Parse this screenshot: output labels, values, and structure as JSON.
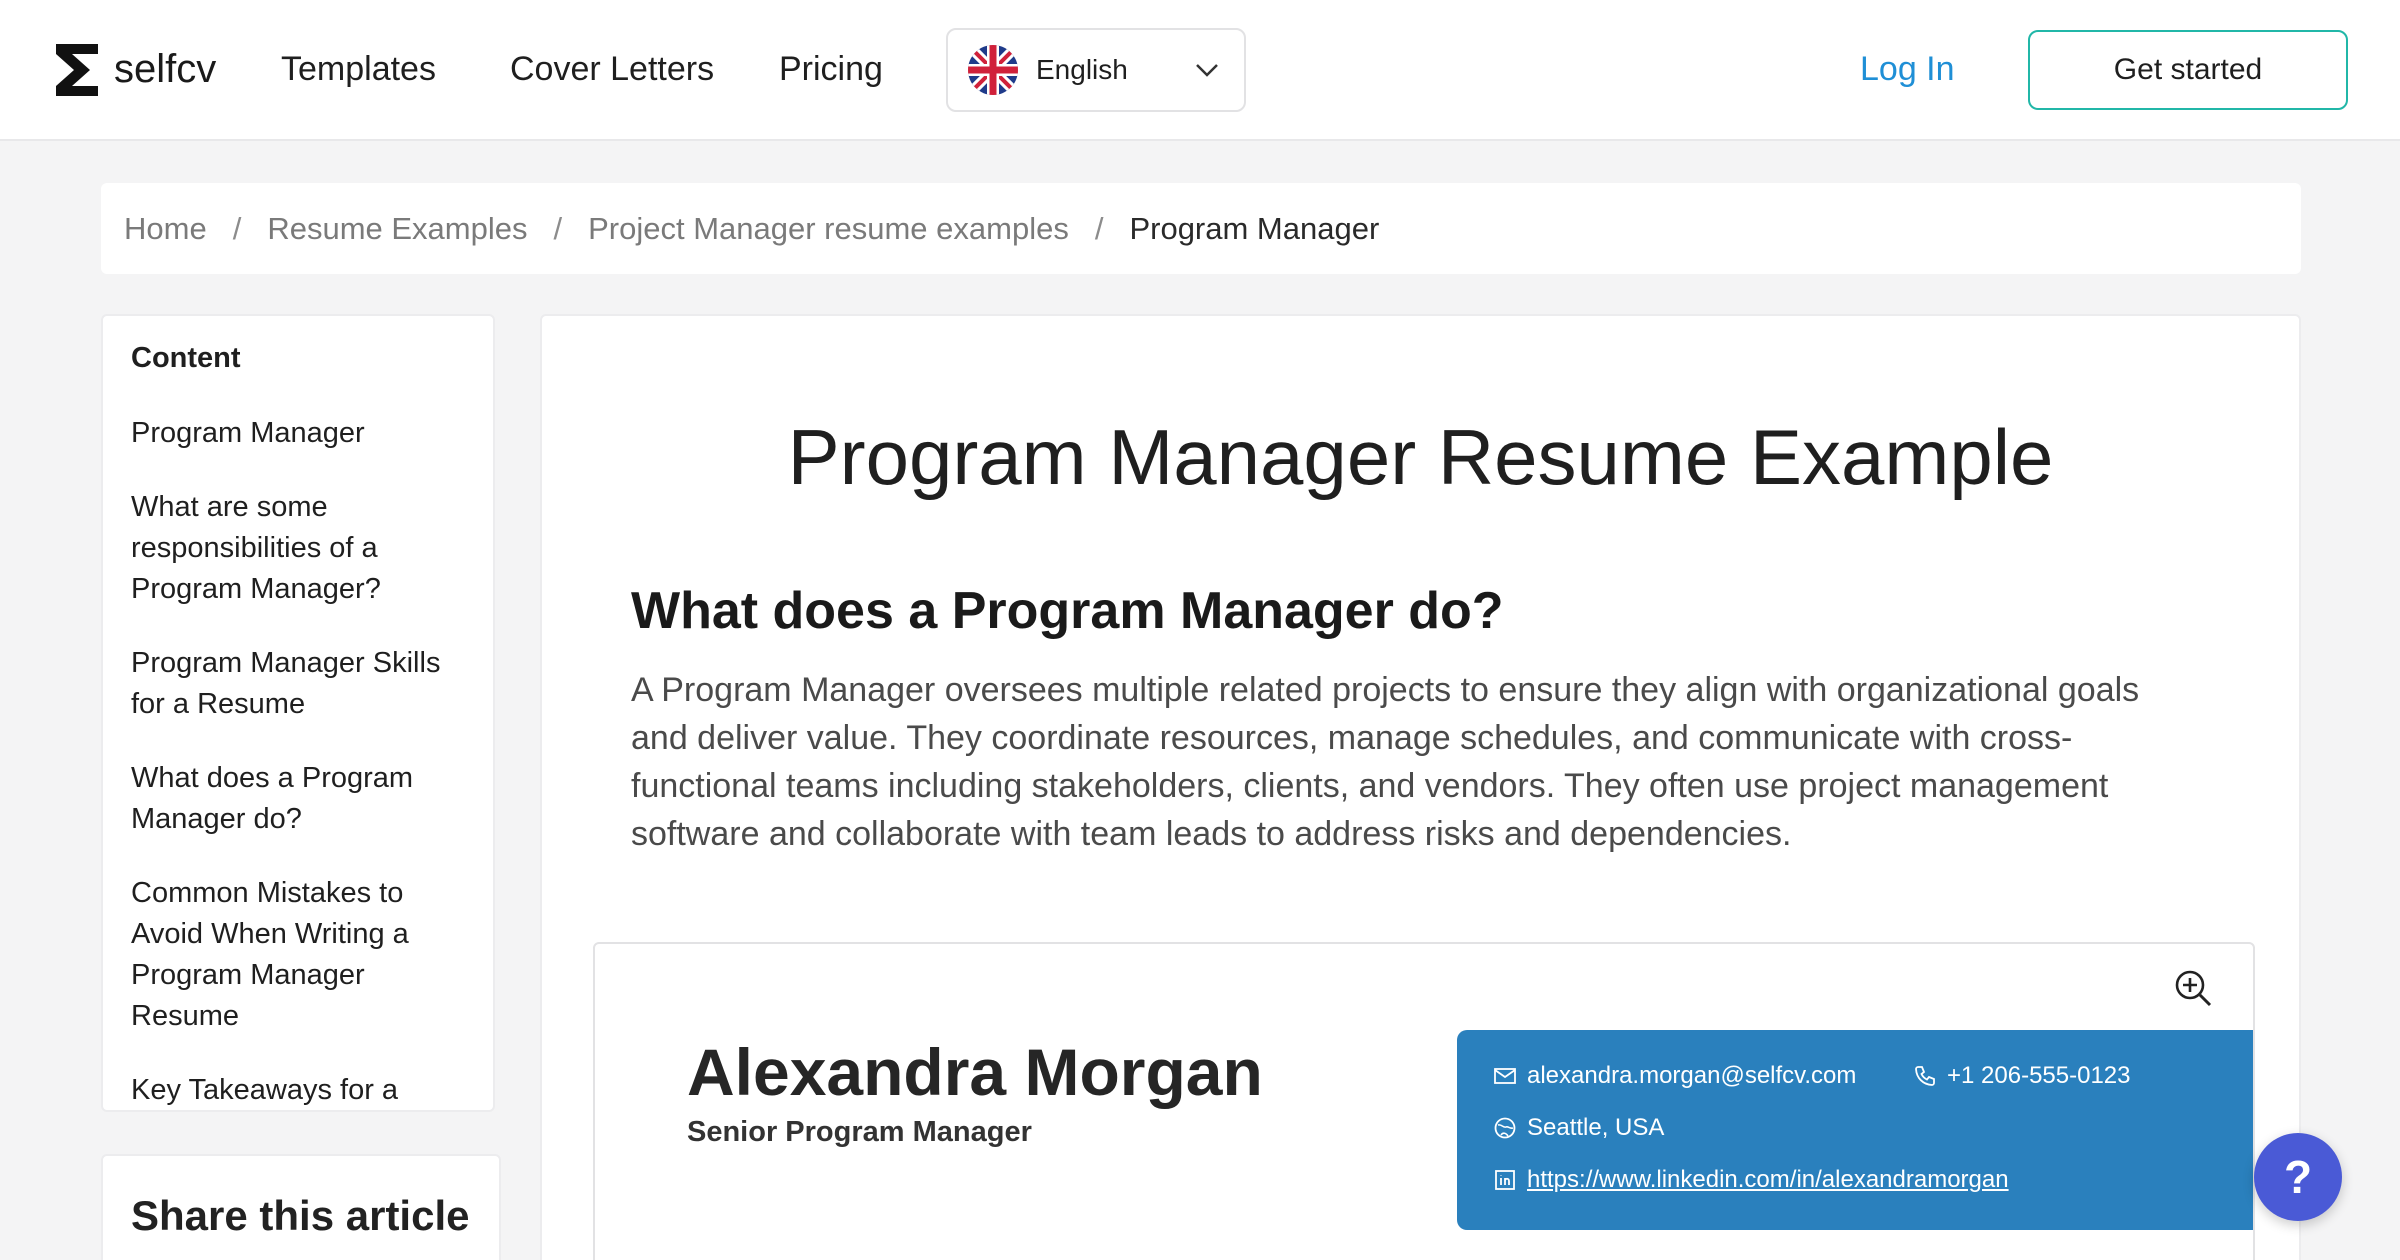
{
  "header": {
    "logo_text": "selfcv",
    "nav": [
      "Templates",
      "Cover Letters",
      "Pricing"
    ],
    "language": "English",
    "login_label": "Log In",
    "cta_label": "Get started"
  },
  "breadcrumb": [
    "Home",
    "Resume Examples",
    "Project Manager resume examples",
    "Program Manager"
  ],
  "toc": {
    "title": "Content",
    "items": [
      "Program Manager",
      "What are some responsibilities of a Program Manager?",
      "Program Manager Skills for a Resume",
      "What does a Program Manager do?",
      "Common Mistakes to Avoid When Writing a Program Manager Resume",
      "Key Takeaways for a"
    ]
  },
  "share": {
    "title": "Share this article"
  },
  "main": {
    "title": "Program Manager Resume Example",
    "section_heading": "What does a Program Manager do?",
    "paragraph": "A Program Manager oversees multiple related projects to ensure they align with organizational goals and deliver value. They coordinate resources, manage schedules, and communicate with cross-functional teams including stakeholders, clients, and vendors. They often use project management software and collaborate with team leads to address risks and dependencies."
  },
  "resume": {
    "name": "Alexandra Morgan",
    "role": "Senior Program Manager",
    "email": "alexandra.morgan@selfcv.com",
    "phone": "+1 206-555-0123",
    "location": "Seattle, USA",
    "linkedin": "https://www.linkedin.com/in/alexandramorgan"
  },
  "help": {
    "label": "?"
  },
  "colors": {
    "accent_teal": "#21b7a8",
    "login_blue": "#1f8fd6",
    "contact_panel": "#2a80bd",
    "help_button": "#4a5ad6"
  }
}
